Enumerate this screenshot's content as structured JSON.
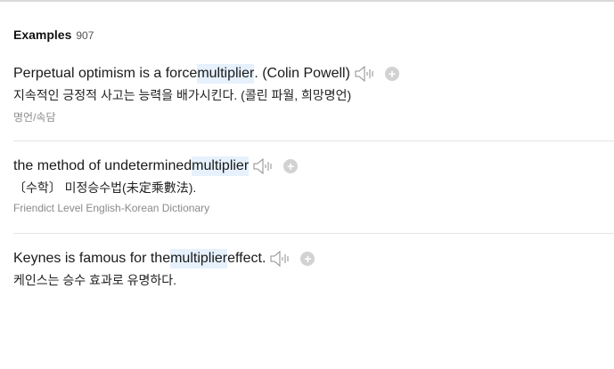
{
  "section": {
    "title": "Examples",
    "count": "907"
  },
  "examples": [
    {
      "pre": "Perpetual optimism is a force ",
      "keyword": "multiplier",
      "post": ". (Colin Powell)",
      "translation": "지속적인 긍정적 사고는 능력을 배가시킨다. (콜린 파월, 희망명언)",
      "source": "명언/속담"
    },
    {
      "pre": "the method of undetermined ",
      "keyword": "multiplier",
      "post": "",
      "translation": "〔수학〕 미정승수법(未定乘數法).",
      "source": "Friendict Level English-Korean Dictionary"
    },
    {
      "pre": "Keynes is famous for the ",
      "keyword": "multiplier",
      "post": " effect.",
      "translation": "케인스는 승수 효과로 유명하다.",
      "source": ""
    }
  ],
  "icons": {
    "audio": "speaker-icon",
    "add": "plus-circle-icon"
  },
  "colors": {
    "highlight": "#e6f1fd",
    "add_button": "#d2d2d2",
    "source_text": "#8a8a8a"
  }
}
